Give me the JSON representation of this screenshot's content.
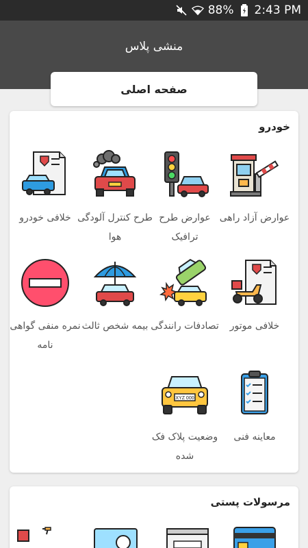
{
  "status": {
    "battery": "88%",
    "time": "2:43 PM"
  },
  "app": {
    "title": "منشی پلاس"
  },
  "tab": {
    "label": "صفحه اصلی"
  },
  "car_section": {
    "title": "خودرو",
    "items": [
      {
        "label": "عوارض آزاد راهی",
        "icon": "toll-gate-icon"
      },
      {
        "label": "عوارض طرح ترافیک",
        "icon": "traffic-light-car-icon"
      },
      {
        "label": "طرح کنترل آلودگی هوا",
        "icon": "car-pollution-icon"
      },
      {
        "label": "خلافی خودرو",
        "icon": "car-fine-document-icon"
      },
      {
        "label": "خلافی موتور",
        "icon": "motorcycle-fine-document-icon"
      },
      {
        "label": "تصادفات رانندگی",
        "icon": "car-accident-icon"
      },
      {
        "label": "بیمه شخص ثالث",
        "icon": "car-insurance-umbrella-icon"
      },
      {
        "label": "نمره منفی گواهی نامه",
        "icon": "no-entry-icon"
      },
      {
        "label": "معاینه فنی",
        "icon": "checklist-clipboard-icon"
      },
      {
        "label": "وضعیت پلاک فک شده",
        "icon": "car-plate-icon",
        "plate_text": "XYZ 000"
      }
    ]
  },
  "post_section": {
    "title": "مرسولات پستی"
  }
}
